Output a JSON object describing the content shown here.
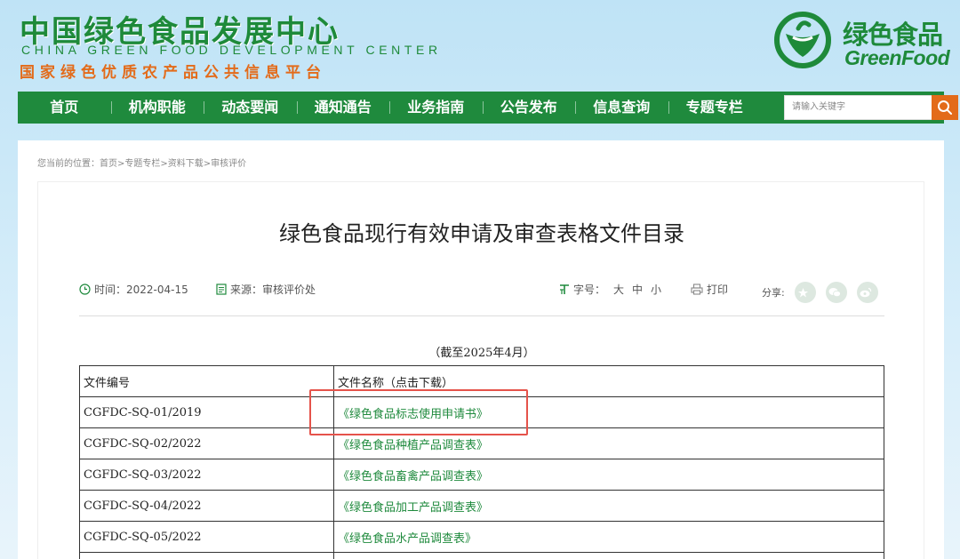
{
  "header": {
    "cn_title": "中国绿色食品发展中心",
    "en_title": "CHINA GREEN FOOD DEVELOPMENT CENTER",
    "sub_title": "国家绿色优质农产品公共信息平台",
    "logo_cn": "绿色食品",
    "logo_en": "GreenFood"
  },
  "nav": {
    "items": [
      "首页",
      "机构职能",
      "动态要闻",
      "通知通告",
      "业务指南",
      "公告发布",
      "信息查询",
      "专题专栏"
    ],
    "search_placeholder": "请输入关键字"
  },
  "breadcrumb": "您当前的位置：首页>专题专栏>资料下载>审核评价",
  "article": {
    "title": "绿色食品现行有效申请及审查表格文件目录",
    "time": "时间：2022-04-15",
    "source": "来源：审核评价处",
    "font_size_label": "字号：",
    "font_sizes": [
      "大",
      "中",
      "小"
    ],
    "print": "打印",
    "share": "分享:",
    "cutoff": "（截至2025年4月）"
  },
  "table": {
    "headers": [
      "文件编号",
      "文件名称（点击下载）"
    ],
    "rows": [
      {
        "code": "CGFDC-SQ-01/2019",
        "name": "《绿色食品标志使用申请书》"
      },
      {
        "code": "CGFDC-SQ-02/2022",
        "name": "《绿色食品种植产品调查表》"
      },
      {
        "code": "CGFDC-SQ-03/2022",
        "name": "《绿色食品畜禽产品调查表》"
      },
      {
        "code": "CGFDC-SQ-04/2022",
        "name": "《绿色食品加工产品调查表》"
      },
      {
        "code": "CGFDC-SQ-05/2022",
        "name": "《绿色食品水产品调查表》"
      }
    ]
  },
  "colors": {
    "brand_green": "#1f8a3d",
    "accent_orange": "#e36b1a",
    "highlight_red": "#e5534b"
  }
}
